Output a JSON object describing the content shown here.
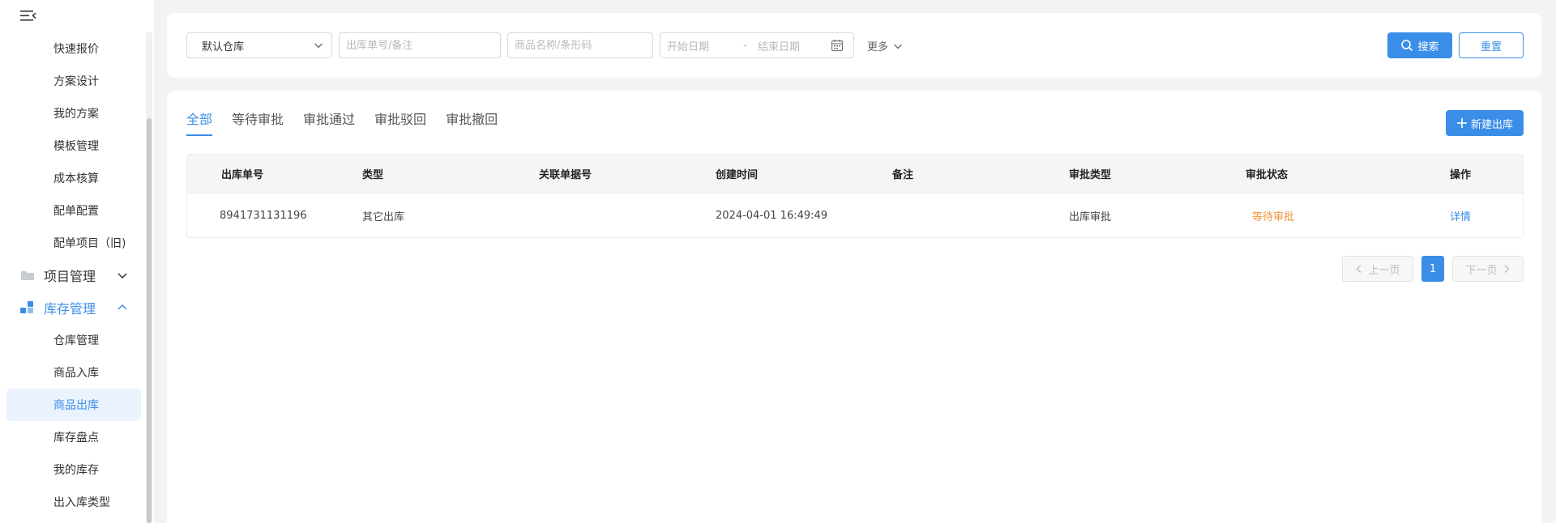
{
  "colors": {
    "accent": "#3b8ee8",
    "warning": "#f0943a",
    "active_bg": "#eaf3fd"
  },
  "sidebar": {
    "toggle_icon": "menu-fold-icon",
    "items_top": [
      {
        "label": "快速报价"
      },
      {
        "label": "方案设计"
      },
      {
        "label": "我的方案"
      },
      {
        "label": "模板管理"
      },
      {
        "label": "成本核算"
      },
      {
        "label": "配单配置"
      },
      {
        "label": "配单项目（旧)"
      }
    ],
    "group_project": {
      "label": "项目管理",
      "icon": "folder-icon",
      "expanded": false
    },
    "group_inventory": {
      "label": "库存管理",
      "icon": "inventory-icon",
      "expanded": true
    },
    "items_inventory": [
      {
        "label": "仓库管理"
      },
      {
        "label": "商品入库"
      },
      {
        "label": "商品出库",
        "active": true
      },
      {
        "label": "库存盘点"
      },
      {
        "label": "我的库存"
      },
      {
        "label": "出入库类型"
      }
    ]
  },
  "search": {
    "warehouse_value": "默认仓库",
    "order_placeholder": "出库单号/备注",
    "product_placeholder": "商品名称/条形码",
    "start_date_placeholder": "开始日期",
    "date_separator": "-",
    "end_date_placeholder": "结束日期",
    "more_label": "更多",
    "search_label": "搜索",
    "reset_label": "重置"
  },
  "tabs": [
    {
      "label": "全部",
      "active": true
    },
    {
      "label": "等待审批"
    },
    {
      "label": "审批通过"
    },
    {
      "label": "审批驳回"
    },
    {
      "label": "审批撤回"
    }
  ],
  "new_button_label": "新建出库",
  "table": {
    "headers": [
      "出库单号",
      "类型",
      "关联单据号",
      "创建时间",
      "备注",
      "审批类型",
      "审批状态",
      "操作"
    ],
    "rows": [
      {
        "order_no": "8941731131196",
        "type": "其它出库",
        "related_no": "",
        "created_at": "2024-04-01 16:49:49",
        "remark": "",
        "approval_type": "出库审批",
        "approval_status": "等待审批",
        "action": "详情"
      }
    ]
  },
  "pagination": {
    "prev_label": "上一页",
    "current_page": "1",
    "next_label": "下一页"
  }
}
